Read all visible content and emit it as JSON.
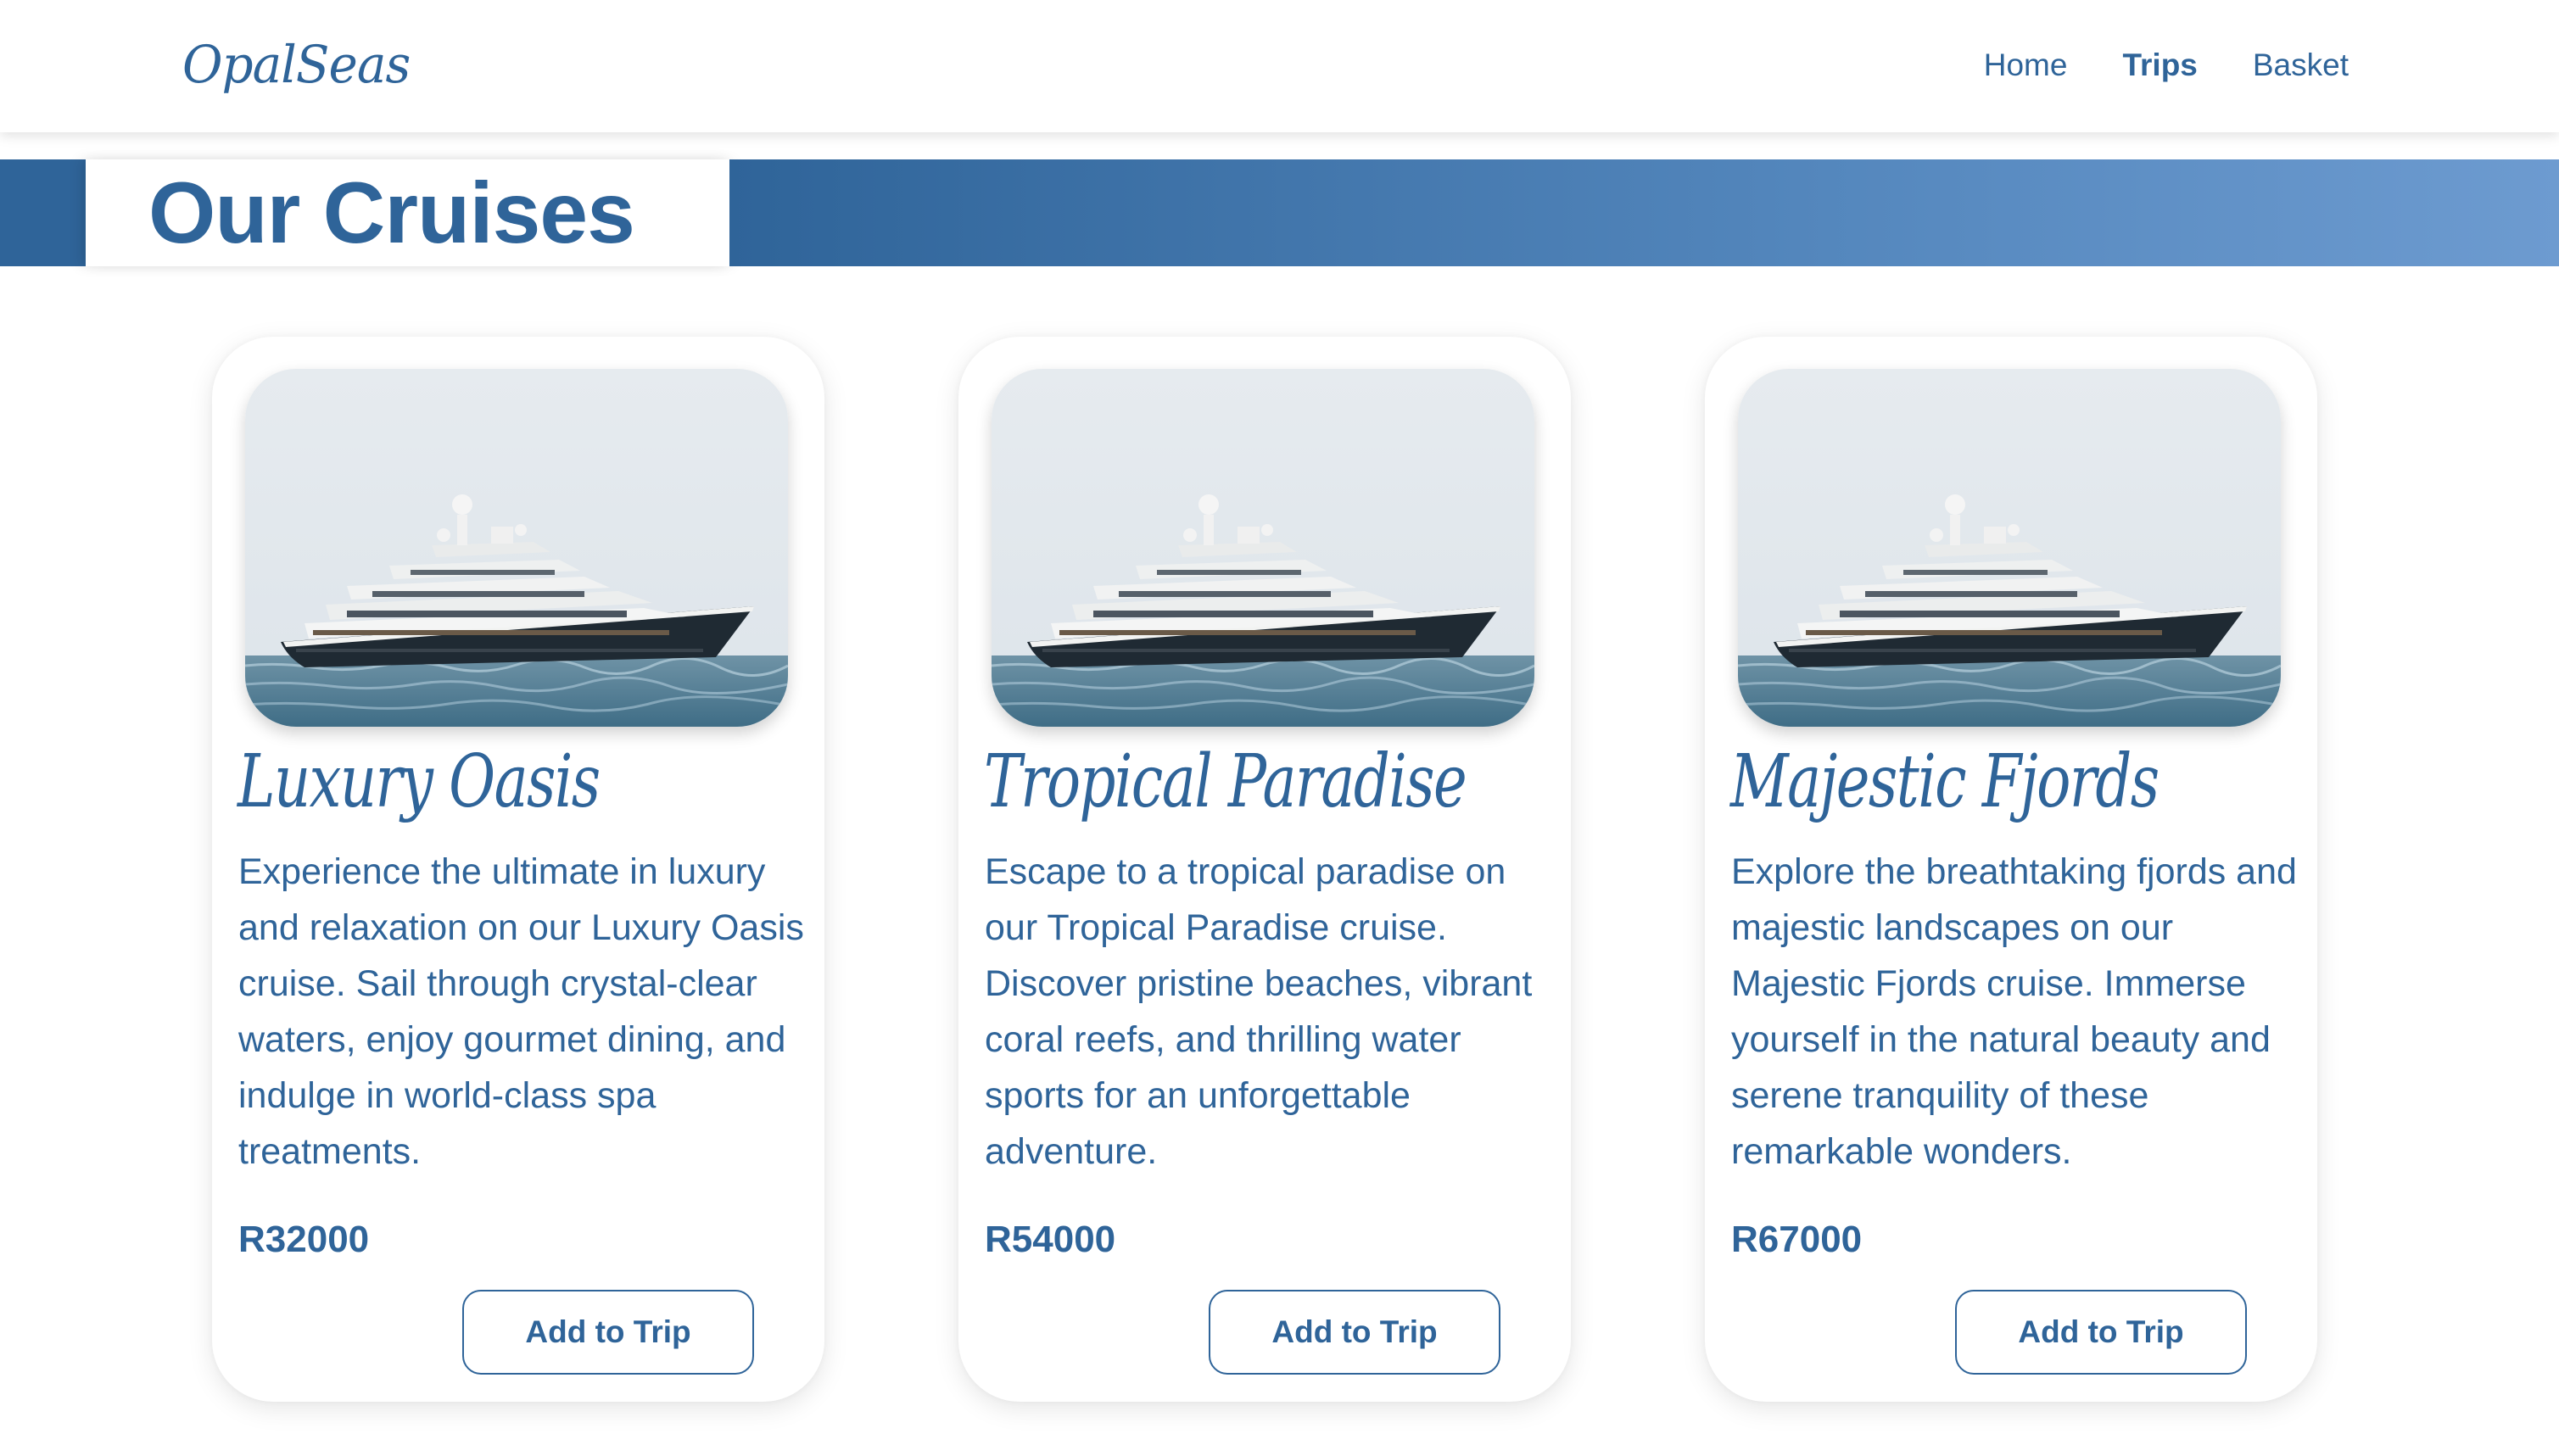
{
  "header": {
    "logo_text": "OpalSeas",
    "nav": [
      {
        "label": "Home",
        "active": false
      },
      {
        "label": "Trips",
        "active": true
      },
      {
        "label": "Basket",
        "active": false
      }
    ]
  },
  "banner": {
    "title": "Our Cruises"
  },
  "cruises": [
    {
      "title": "Luxury Oasis",
      "description": "Experience the ultimate in luxury and relaxation on our Luxury Oasis cruise. Sail through crystal-clear waters, enjoy gourmet dining, and indulge in world-class spa treatments.",
      "price": "R32000",
      "button_label": "Add to Trip",
      "image": "yacht-photo"
    },
    {
      "title": "Tropical Paradise",
      "description": "Escape to a tropical paradise on our Tropical Paradise cruise. Discover pristine beaches, vibrant coral reefs, and thrilling water sports for an unforgettable adventure.",
      "price": "R54000",
      "button_label": "Add to Trip",
      "image": "yacht-photo"
    },
    {
      "title": "Majestic Fjords",
      "description": "Explore the breathtaking fjords and majestic landscapes on our Majestic Fjords cruise. Immerse yourself in the natural beauty and serene tranquility of these remarkable wonders.",
      "price": "R67000",
      "button_label": "Add to Trip",
      "image": "yacht-photo"
    }
  ],
  "colors": {
    "brand": "#2f6499",
    "gradient_end": "#6d9bd0",
    "background": "#ffffff"
  }
}
